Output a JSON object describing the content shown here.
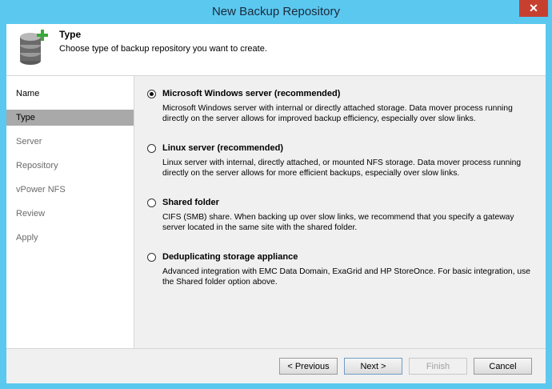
{
  "window": {
    "title": "New Backup Repository",
    "close_glyph": "✕"
  },
  "header": {
    "title": "Type",
    "subtitle": "Choose type of backup repository you want to create.",
    "icon": "database-add-icon"
  },
  "sidebar": {
    "items": [
      {
        "label": "Name"
      },
      {
        "label": "Type"
      },
      {
        "label": "Server"
      },
      {
        "label": "Repository"
      },
      {
        "label": "vPower NFS"
      },
      {
        "label": "Review"
      },
      {
        "label": "Apply"
      }
    ],
    "active": "Type"
  },
  "options": [
    {
      "label": "Microsoft Windows server (recommended)",
      "desc": "Microsoft Windows server with internal or directly attached storage. Data mover process running directly on the server allows for improved backup efficiency, especially over slow links.",
      "checked": true
    },
    {
      "label": "Linux server (recommended)",
      "desc": "Linux server with internal, directly attached, or mounted NFS storage. Data mover process running directly on the server allows for more efficient backups, especially over slow links.",
      "checked": false
    },
    {
      "label": "Shared folder",
      "desc": "CIFS (SMB) share. When backing up over slow links, we recommend that you specify a gateway server located in the same site with the shared folder.",
      "checked": false
    },
    {
      "label": "Deduplicating storage appliance",
      "desc": "Advanced integration with EMC Data Domain, ExaGrid and HP StoreOnce. For basic integration, use the Shared folder option above.",
      "checked": false
    }
  ],
  "footer": {
    "previous_label": "< Previous",
    "next_label": "Next >",
    "finish_label": "Finish",
    "cancel_label": "Cancel"
  },
  "colors": {
    "titlebar": "#5bc8f0",
    "close": "#c7402f",
    "active_step": "#a9a9a9",
    "icon_accent": "#3aa83a"
  }
}
